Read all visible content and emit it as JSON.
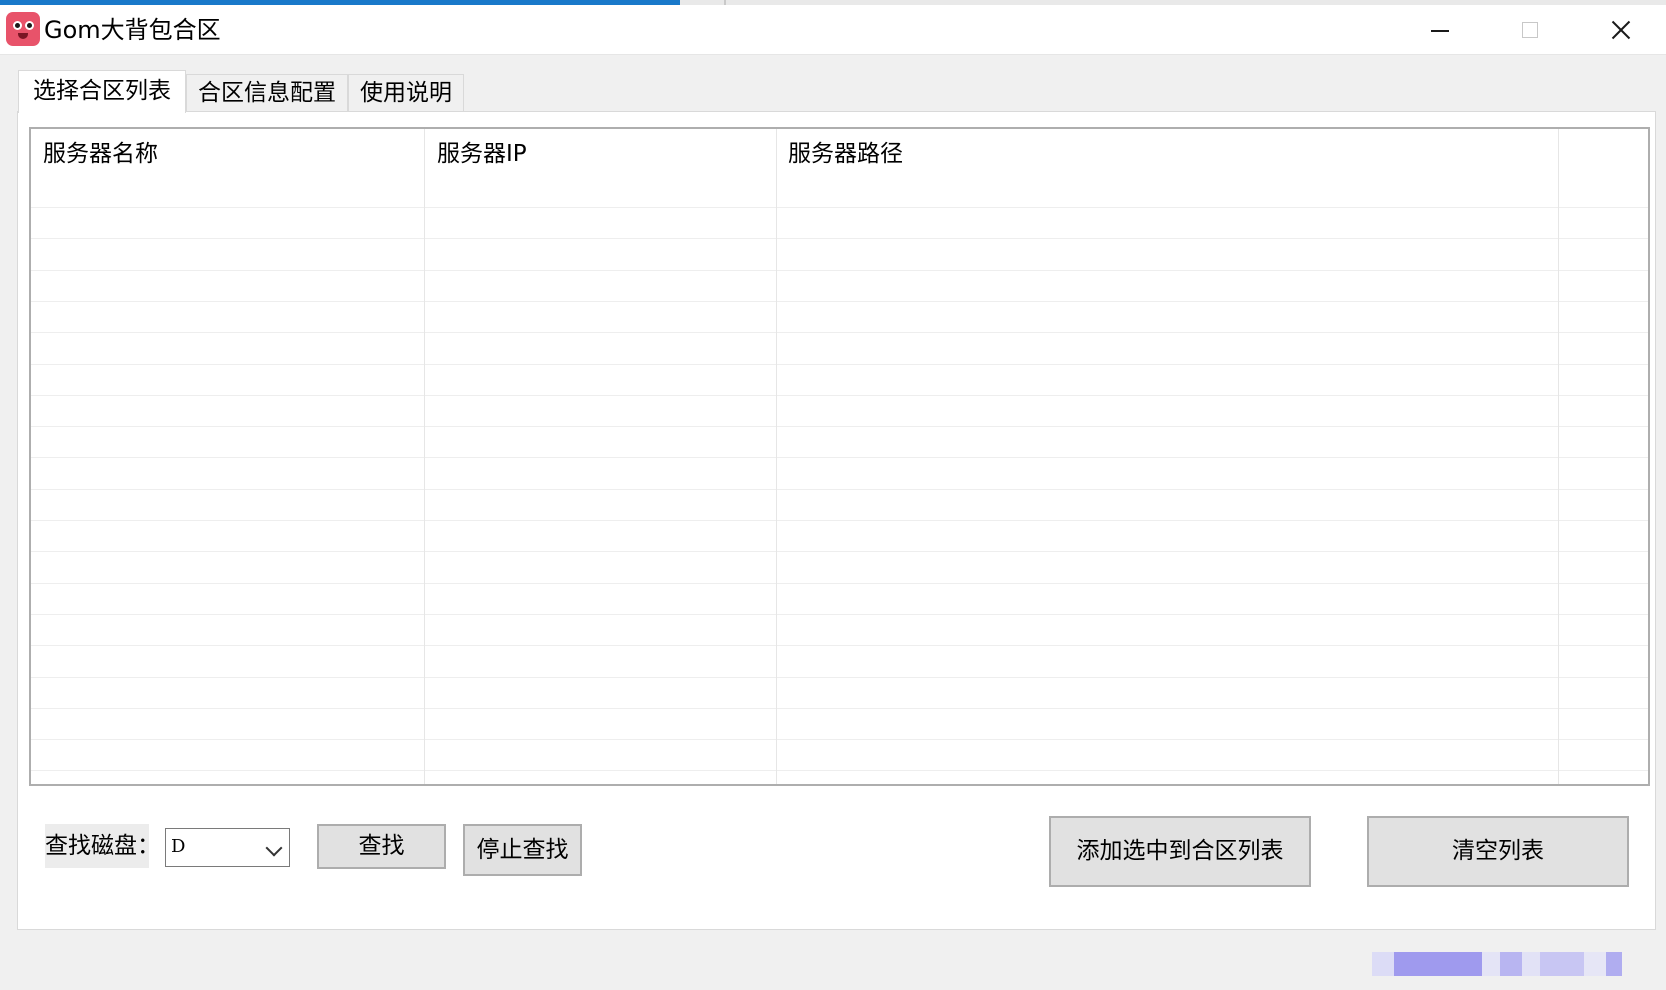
{
  "window": {
    "title": "Gom大背包合区",
    "app_icon": "pink-face-icon",
    "controls": [
      "minimize-icon",
      "maximize-icon",
      "close-icon"
    ],
    "accent_color": "#1979ca"
  },
  "tabs": [
    {
      "label": "选择合区列表",
      "active": true
    },
    {
      "label": "合区信息配置",
      "active": false
    },
    {
      "label": "使用说明",
      "active": false
    }
  ],
  "server_list": {
    "columns": [
      "服务器名称",
      "服务器IP",
      "服务器路径",
      ""
    ],
    "rows": []
  },
  "controls": {
    "disk_label": "查找磁盘：",
    "disk_value": "D",
    "find_label": "查找",
    "stop_label": "停止查找",
    "add_label": "添加选中到合区列表",
    "clear_label": "清空列表"
  }
}
